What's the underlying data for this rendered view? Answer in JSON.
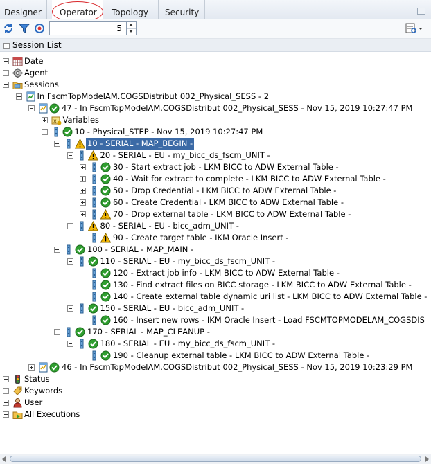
{
  "tabs": [
    {
      "label": "Designer"
    },
    {
      "label": "Operator"
    },
    {
      "label": "Topology"
    },
    {
      "label": "Security"
    }
  ],
  "toolbar": {
    "spinner_value": "5"
  },
  "session_list": {
    "title": "Session List"
  },
  "tree": [
    {
      "id": "date",
      "label": "Date",
      "icon": "calendar-icon",
      "level": 0,
      "expand": "plus"
    },
    {
      "id": "agent",
      "label": "Agent",
      "icon": "gear-icon",
      "level": 0,
      "expand": "plus"
    },
    {
      "id": "sessions",
      "label": "Sessions",
      "icon": "folder-icon",
      "level": 0,
      "expand": "minus"
    },
    {
      "id": "scen",
      "label": "In FscmTopModelAM.COGSDistribut 002_Physical_SESS - 2",
      "icon": "scenario-icon",
      "level": 1,
      "expand": "minus"
    },
    {
      "id": "s47",
      "label": "47 - In FscmTopModelAM.COGSDistribut 002_Physical_SESS - Nov 15, 2019 10:27:47 PM",
      "icon": "session-ok-icon",
      "level": 2,
      "expand": "minus"
    },
    {
      "id": "vars",
      "label": "Variables",
      "icon": "variables-icon",
      "level": 3,
      "expand": "plus"
    },
    {
      "id": "step10",
      "label": "10 - Physical_STEP - Nov 15, 2019 10:27:47 PM",
      "icon": "step-ok-icon",
      "level": 3,
      "expand": "minus"
    },
    {
      "id": "map_begin",
      "label": "10 - SERIAL - MAP_BEGIN -",
      "icon": "serial-warning-icon",
      "level": 4,
      "expand": "minus",
      "selected": true
    },
    {
      "id": "eu20",
      "label": "20 - SERIAL - EU - my_bicc_ds_fscm_UNIT -",
      "icon": "serial-warning-icon",
      "level": 5,
      "expand": "minus"
    },
    {
      "id": "t30",
      "label": "30 - Start extract job - LKM BICC to ADW External Table -",
      "icon": "task-ok-icon",
      "level": 6,
      "expand": "plus"
    },
    {
      "id": "t40",
      "label": "40 - Wait for extract to complete - LKM BICC to ADW External Table -",
      "icon": "task-ok-icon",
      "level": 6,
      "expand": "plus"
    },
    {
      "id": "t50",
      "label": "50 - Drop Credential - LKM BICC to ADW External Table -",
      "icon": "task-ok-icon",
      "level": 6,
      "expand": "plus"
    },
    {
      "id": "t60",
      "label": "60 - Create Credential - LKM BICC to ADW External Table -",
      "icon": "task-ok-icon",
      "level": 6,
      "expand": "plus"
    },
    {
      "id": "t70",
      "label": "70 - Drop external table - LKM BICC to ADW External Table -",
      "icon": "task-warning-icon",
      "level": 6,
      "expand": "plus"
    },
    {
      "id": "eu80",
      "label": "80 - SERIAL - EU - bicc_adm_UNIT -",
      "icon": "serial-warning-icon",
      "level": 5,
      "expand": "minus"
    },
    {
      "id": "t90",
      "label": "90 - Create target table - IKM Oracle Insert -",
      "icon": "task-warning-icon",
      "level": 6,
      "expand": "none"
    },
    {
      "id": "map_main",
      "label": "100 - SERIAL - MAP_MAIN -",
      "icon": "serial-ok-icon",
      "level": 4,
      "expand": "minus"
    },
    {
      "id": "eu110",
      "label": "110 - SERIAL - EU - my_bicc_ds_fscm_UNIT -",
      "icon": "serial-ok-icon",
      "level": 5,
      "expand": "minus"
    },
    {
      "id": "t120",
      "label": "120 - Extract job info - LKM BICC to ADW External Table -",
      "icon": "task-ok-icon",
      "level": 6,
      "expand": "none"
    },
    {
      "id": "t130",
      "label": "130 - Find extract files on BICC storage - LKM BICC to ADW External Table -",
      "icon": "task-ok-icon",
      "level": 6,
      "expand": "none"
    },
    {
      "id": "t140",
      "label": "140 - Create external table dynamic uri list - LKM BICC to ADW External Table -",
      "icon": "task-ok-icon",
      "level": 6,
      "expand": "none"
    },
    {
      "id": "eu150",
      "label": "150 - SERIAL - EU - bicc_adm_UNIT -",
      "icon": "serial-ok-icon",
      "level": 5,
      "expand": "minus"
    },
    {
      "id": "t160",
      "label": "160 - Insert new rows - IKM Oracle Insert - Load FSCMTOPMODELAM_COGSDIS",
      "icon": "task-ok-icon",
      "level": 6,
      "expand": "none"
    },
    {
      "id": "cleanup",
      "label": "170 - SERIAL - MAP_CLEANUP -",
      "icon": "serial-ok-icon",
      "level": 4,
      "expand": "minus"
    },
    {
      "id": "eu180",
      "label": "180 - SERIAL - EU - my_bicc_ds_fscm_UNIT -",
      "icon": "serial-ok-icon",
      "level": 5,
      "expand": "minus"
    },
    {
      "id": "t190",
      "label": "190 - Cleanup external table - LKM BICC to ADW External Table -",
      "icon": "task-ok-icon",
      "level": 6,
      "expand": "none"
    },
    {
      "id": "s46",
      "label": "46 - In FscmTopModelAM.COGSDistribut 002_Physical_SESS - Nov 15, 2019 10:23:29 PM",
      "icon": "session-ok-icon",
      "level": 2,
      "expand": "plus"
    },
    {
      "id": "status",
      "label": "Status",
      "icon": "traffic-light-icon",
      "level": 0,
      "expand": "plus"
    },
    {
      "id": "keywords",
      "label": "Keywords",
      "icon": "keywords-icon",
      "level": 0,
      "expand": "plus"
    },
    {
      "id": "user",
      "label": "User",
      "icon": "user-icon",
      "level": 0,
      "expand": "plus"
    },
    {
      "id": "allexec",
      "label": "All Executions",
      "icon": "all-executions-icon",
      "level": 0,
      "expand": "plus"
    }
  ],
  "colors": {
    "ok": "#2f9e2f",
    "warning": "#f2b705",
    "selection": "#3b6aa6",
    "highlight": "#d9282c"
  }
}
